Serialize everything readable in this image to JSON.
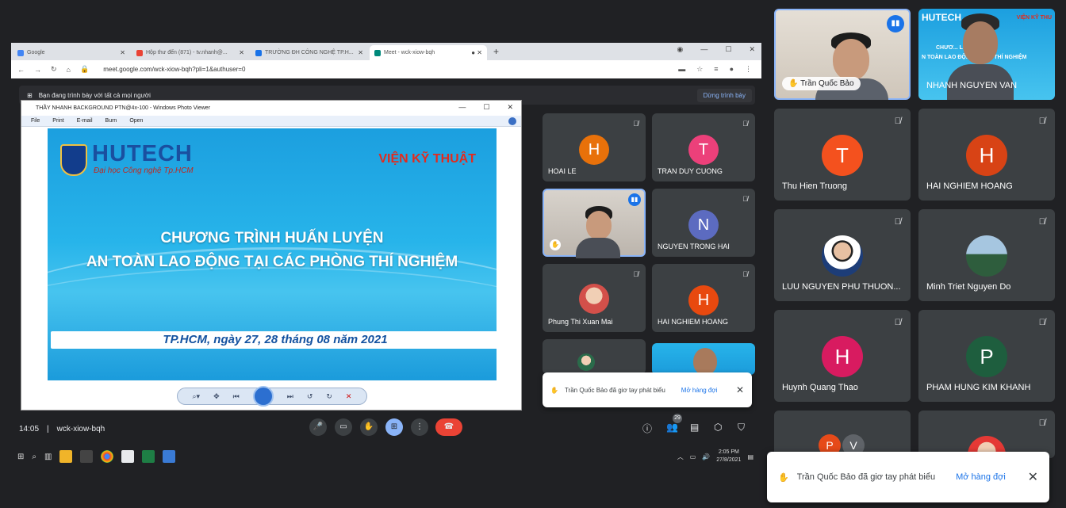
{
  "browser": {
    "tabs": [
      {
        "title": "Google",
        "color": "#4285f4"
      },
      {
        "title": "Hộp thư đến (871) - tv.nhanh@...",
        "color": "#ea4335"
      },
      {
        "title": "TRƯỜNG ĐH CÔNG NGHỆ TP.H...",
        "color": "#1a73e8"
      },
      {
        "title": "Meet - wck-xiow-bqh",
        "color": "#00897b"
      }
    ],
    "new_tab": "+",
    "url": "meet.google.com/wck-xiow-bqh?pli=1&authuser=0"
  },
  "presenting": {
    "label": "Bạn đang trình bày với tất cả mọi người",
    "stop_button": "Dừng trình bày"
  },
  "viewer": {
    "title": "THẦY NHANH BACKGROUND PTN@4x-100 - Windows Photo Viewer",
    "menu": [
      "File",
      "Print",
      "E-mail",
      "Burn",
      "Open"
    ]
  },
  "slide": {
    "logo": "HUTECH",
    "logo_sub": "Đại học Công nghệ Tp.HCM",
    "institute": "VIỆN KỸ THUẬT",
    "title_line1": "CHƯƠNG TRÌNH HUẤN LUYỆN",
    "title_line2": "AN TOÀN LAO ĐỘNG TẠI CÁC PHÒNG THÍ NGHIỆM",
    "date": "TP.HCM, ngày 27, 28 tháng 08 năm 2021"
  },
  "middle_tiles": [
    {
      "name": "HOAI LE",
      "initial": "H",
      "color": "#e8710a"
    },
    {
      "name": "TRAN DUY CUONG",
      "initial": "T",
      "color": "#ec407a"
    },
    {
      "name": "NGUYEN TRONG HAI",
      "initial": "N",
      "color": "#5c6bc0"
    },
    {
      "name": "Phung Thi Xuan Mai",
      "initial": "",
      "color": ""
    },
    {
      "name": "HAI NGHIEM HOANG",
      "initial": "H",
      "color": "#e8490f"
    }
  ],
  "notification_small": {
    "text": "Trần Quốc Bảo đã giơ tay phát biểu",
    "link": "Mở hàng đợi"
  },
  "bottom": {
    "time": "14:05",
    "meeting_code": "wck-xiow-bqh",
    "participants_count": "29"
  },
  "taskbar": {
    "time": "2:05 PM",
    "date": "27/8/2021"
  },
  "right_tiles": [
    {
      "name": "Trần Quốc Bảo"
    },
    {
      "name": "NHANH NGUYEN VAN",
      "logo": "HUTECH",
      "text1": "CHƯƠ... LUYỆN",
      "text2": "N TOÀN LAO ĐỘ... PHÒNG THÍ NGHIỆM",
      "vien": "VIỆN KỸ THU"
    },
    {
      "name": "Thu Hien Truong",
      "initial": "T",
      "color": "#f4511e"
    },
    {
      "name": "HAI NGHIEM HOANG",
      "initial": "H",
      "color": "#d84315"
    },
    {
      "name": "LUU NGUYEN PHU THUON..."
    },
    {
      "name": "Minh Triet Nguyen Do"
    },
    {
      "name": "Huynh Quang Thao",
      "initial": "H",
      "color": "#d81b60"
    },
    {
      "name": "PHAM HUNG KIM KHANH",
      "initial": "P",
      "color": "#1e5e3e"
    },
    {
      "name": "",
      "initials": [
        "P",
        "V"
      ],
      "colors": [
        "#e64a19",
        "#5f6368"
      ]
    }
  ],
  "notification_big": {
    "text": "Trần Quốc Bảo đã giơ tay phát biểu",
    "link": "Mở hàng đợi"
  }
}
